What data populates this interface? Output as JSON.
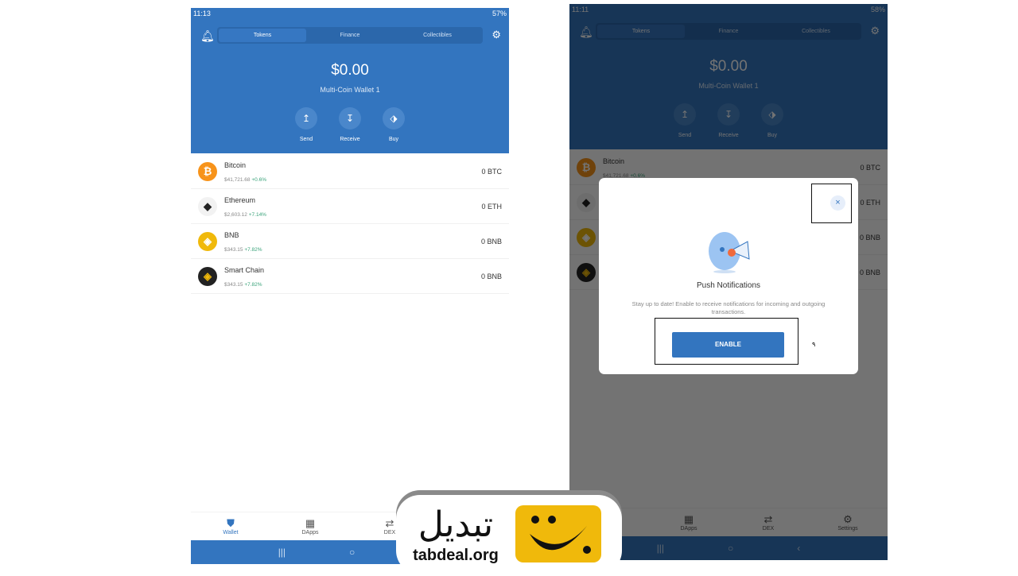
{
  "left_phone": {
    "time": "11:13",
    "battery": "57%"
  },
  "right_phone": {
    "time": "11:11",
    "battery": "58%"
  },
  "tabs": [
    "Tokens",
    "Finance",
    "Collectibles"
  ],
  "balance": "$0.00",
  "wallet_name": "Multi-Coin Wallet 1",
  "actions": [
    {
      "label": "Send",
      "icon": "↥"
    },
    {
      "label": "Receive",
      "icon": "↧"
    },
    {
      "label": "Buy",
      "icon": "⬗"
    }
  ],
  "tokens": [
    {
      "name": "Bitcoin",
      "price": "$41,721.68",
      "change": "+0.6%",
      "amount": "0 BTC",
      "color": "#f7931a",
      "glyph": "₿",
      "fg": "#fff"
    },
    {
      "name": "Ethereum",
      "price": "$2,603.12",
      "change": "+7.14%",
      "amount": "0 ETH",
      "color": "#f2f2f2",
      "glyph": "◆",
      "fg": "#222"
    },
    {
      "name": "BNB",
      "price": "$343.15",
      "change": "+7.82%",
      "amount": "0 BNB",
      "color": "#f0b90b",
      "glyph": "◈",
      "fg": "#fff"
    },
    {
      "name": "Smart Chain",
      "price": "$343.15",
      "change": "+7.82%",
      "amount": "0 BNB",
      "color": "#222",
      "glyph": "◈",
      "fg": "#f0b90b"
    }
  ],
  "nav": [
    "Wallet",
    "DApps",
    "DEX",
    "Settings"
  ],
  "modal": {
    "title": "Push Notifications",
    "description": "Stay up to date! Enable to receive notifications for incoming and outgoing transactions.",
    "button": "ENABLE",
    "close": "×",
    "note": "۹"
  },
  "logo": {
    "arabic": "تبدیل",
    "latin": "tabdeal.org"
  },
  "colors": {
    "primary": "#3375bf",
    "positive": "#3aa37a",
    "logo_yellow": "#f0b90b"
  }
}
